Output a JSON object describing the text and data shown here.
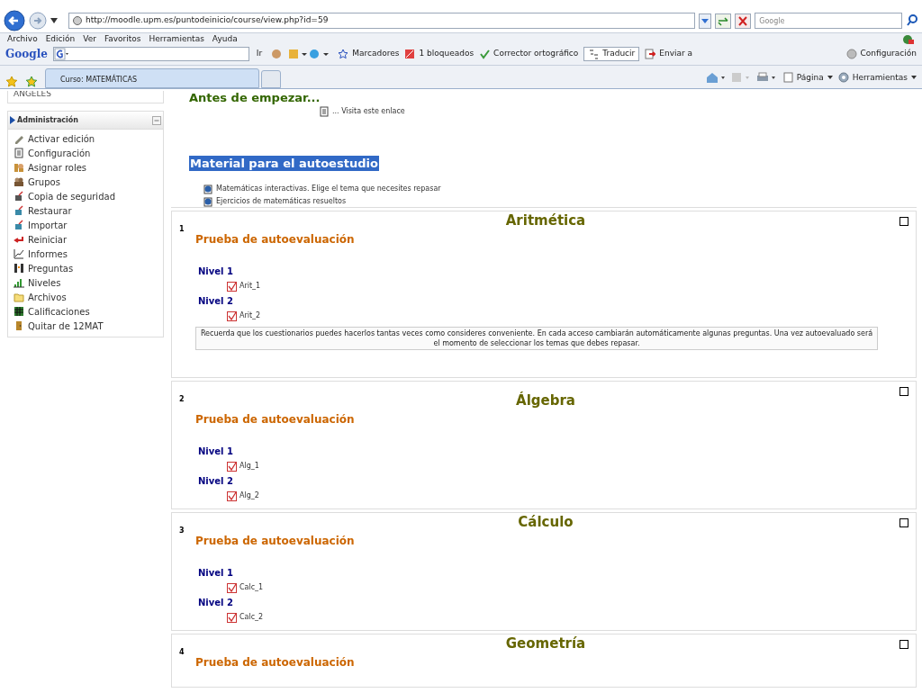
{
  "browser": {
    "url": "http://moodle.upm.es/puntodeinicio/course/view.php?id=59",
    "search_placeholder": "Google",
    "menu": [
      "Archivo",
      "Edición",
      "Ver",
      "Favoritos",
      "Herramientas",
      "Ayuda"
    ],
    "google_bar": {
      "logo": "Google",
      "go": "Ir",
      "bookmarks": "Marcadores",
      "blocked": "1 bloqueados",
      "spell": "Corrector ortográfico",
      "translate": "Traducir",
      "send": "Enviar a",
      "settings": "Configuración"
    },
    "tab": "Curso: MATEMÁTICAS",
    "command_bar": [
      "Página",
      "Herramientas"
    ]
  },
  "sidebar": {
    "top_text": "ANGELES",
    "block_title": "Administración",
    "items": [
      "Activar edición",
      "Configuración",
      "Asignar roles",
      "Grupos",
      "Copia de seguridad",
      "Restaurar",
      "Importar",
      "Reiniciar",
      "Informes",
      "Preguntas",
      "Niveles",
      "Archivos",
      "Calificaciones",
      "Quitar de 12MAT"
    ]
  },
  "intro": {
    "title": "Antes de empezar...",
    "link": "... Visita este enlace",
    "heading": "Material para el autoestudio",
    "heading_selected": true,
    "resources": [
      "Matemáticas interactivas. Elige el tema que necesites repasar",
      "Ejercicios de matemáticas resueltos"
    ]
  },
  "sections": [
    {
      "number": "1",
      "title": "Aritmética",
      "subtitle": "Prueba de autoevaluación",
      "levels": [
        {
          "label": "Nivel 1",
          "items": [
            "Arit_1"
          ]
        },
        {
          "label": "Nivel 2",
          "items": [
            "Arit_2"
          ]
        }
      ],
      "note": "Recuerda que los cuestionarios puedes hacerlos tantas veces como consideres conveniente. En cada acceso cambiarán automáticamente algunas preguntas. Una vez autoevaluado será el momento de seleccionar los temas que debes repasar."
    },
    {
      "number": "2",
      "title": "Álgebra",
      "subtitle": "Prueba de autoevaluación",
      "levels": [
        {
          "label": "Nivel 1",
          "items": [
            "Alg_1"
          ]
        },
        {
          "label": "Nivel 2",
          "items": [
            "Alg_2"
          ]
        }
      ]
    },
    {
      "number": "3",
      "title": "Cálculo",
      "subtitle": "Prueba de autoevaluación",
      "levels": [
        {
          "label": "Nivel 1",
          "items": [
            "Calc_1"
          ]
        },
        {
          "label": "Nivel 2",
          "items": [
            "Calc_2"
          ]
        }
      ]
    },
    {
      "number": "4",
      "title": "Geometría",
      "subtitle": "Prueba de autoevaluación"
    }
  ]
}
